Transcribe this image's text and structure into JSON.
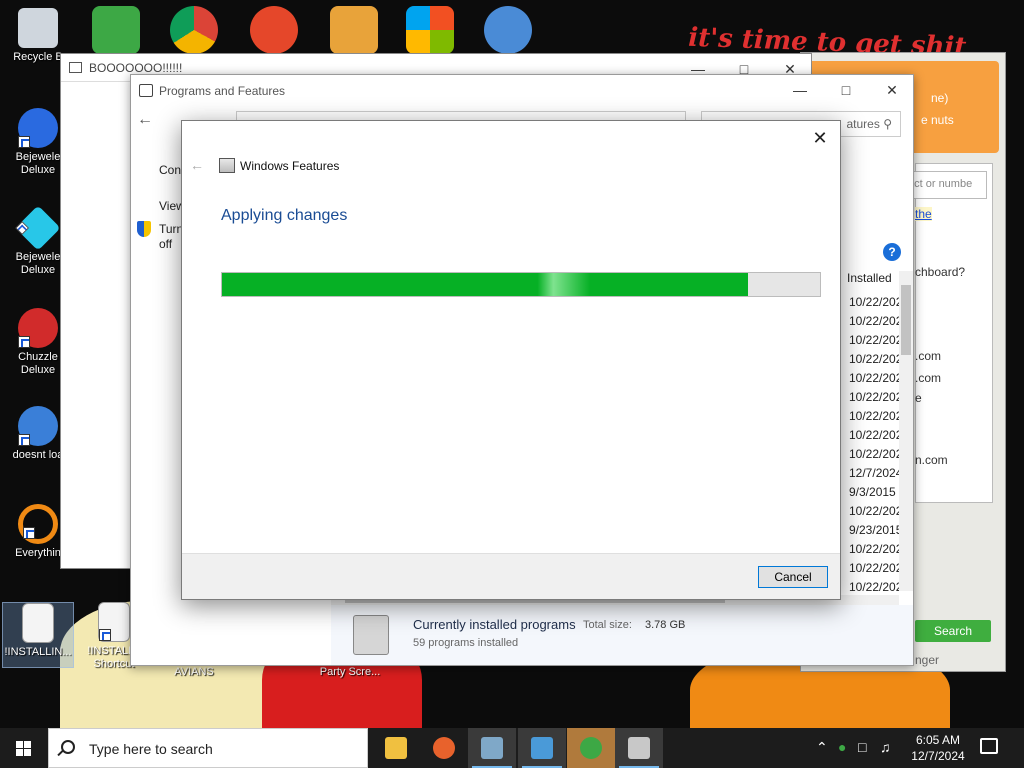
{
  "desktop": {
    "banner_text": "it's time to get shit",
    "icons": [
      {
        "label": "Recycle Bin",
        "display": "Recycle B",
        "icon": "recycle-bin-icon"
      },
      {
        "label": "Bejeweled Deluxe",
        "display": "Bejewele Deluxe",
        "icon": "bejeweled-icon"
      },
      {
        "label": "Bejeweled Deluxe",
        "display": "Bejewele Deluxe",
        "icon": "bejeweled-diamond-icon"
      },
      {
        "label": "Chuzzle Deluxe",
        "display": "Chuzzle Deluxe",
        "icon": "chuzzle-icon"
      },
      {
        "label": "doesnt load",
        "display": "doesnt loa",
        "icon": "thunderbird-icon"
      },
      {
        "label": "Everything",
        "display": "Everythin",
        "icon": "everything-search-icon"
      },
      {
        "label": "!INSTALLING...",
        "display": "!INSTALLIN...",
        "icon": "text-file-icon"
      },
      {
        "label": "!INSTALL - Shortcut",
        "display": "!INSTALL - Shortcut",
        "icon": "text-file-icon"
      },
      {
        "label": "AVIANS",
        "display": "AVIANS",
        "icon": "folder-icon"
      },
      {
        "label": "Party Scre...",
        "display": "Party Scre...",
        "icon": "party-icon"
      }
    ]
  },
  "windows": {
    "boo": {
      "title": "BOOOOOOO!!!!!!"
    },
    "programs_features": {
      "title": "Programs and Features",
      "search_placeholder": "atures",
      "side_links": [
        "Con",
        "View",
        "Turn",
        "off"
      ],
      "column_header": "Installed",
      "install_dates": [
        "10/22/202",
        "10/22/202",
        "10/22/202",
        "10/22/202",
        "10/22/202",
        "10/22/202",
        "10/22/202",
        "10/22/202",
        "10/22/202",
        "12/7/2024",
        "9/3/2015",
        "10/22/202",
        "9/23/2015",
        "10/22/202",
        "10/22/202",
        "10/22/202"
      ],
      "status_title": "Currently installed programs",
      "total_size_label": "Total size:",
      "total_size_value": "3.78 GB",
      "programs_count": "59 programs installed"
    },
    "right_app": {
      "line1": "ne)",
      "line2": "e nuts",
      "field_placeholder": "act or numbe",
      "link_text": "the",
      "question": "chboard?",
      "domains": [
        ".com",
        ".com",
        "e",
        "n.com"
      ],
      "search_label": "Search",
      "bottom_text": "nger"
    },
    "features_dialog": {
      "title": "Windows Features",
      "heading": "Applying changes",
      "progress": 0.88,
      "cancel_label": "Cancel"
    }
  },
  "taskbar": {
    "search_placeholder": "Type here to search",
    "apps": [
      "file-explorer-icon",
      "firefox-icon",
      "app-icon",
      "app-icon",
      "users-icon",
      "features-icon"
    ],
    "time": "6:05 AM",
    "date": "12/7/2024"
  }
}
